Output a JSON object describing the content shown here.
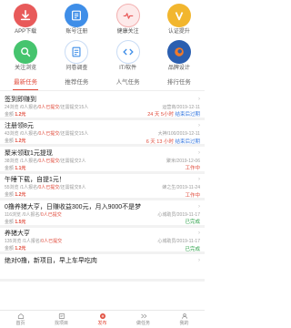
{
  "grid": [
    {
      "label": "APP下载",
      "icon": "download-icon",
      "color": "#e85a5a"
    },
    {
      "label": "账号注册",
      "icon": "register-icon",
      "color": "#3f8ee8"
    },
    {
      "label": "健康关注",
      "icon": "health-icon",
      "color": "#f07070"
    },
    {
      "label": "认证提升",
      "icon": "verify-icon",
      "color": "#f2b62e"
    },
    {
      "label": "关注浏览",
      "icon": "browse-icon",
      "color": "#46c46e"
    },
    {
      "label": "问卷调查",
      "icon": "survey-icon",
      "color": "#3f8ee8"
    },
    {
      "label": "IT/软件",
      "icon": "software-icon",
      "color": "#3f8ee8"
    },
    {
      "label": "品牌设计",
      "icon": "firefox-icon",
      "color": "#f07a2a"
    }
  ],
  "tabs": [
    "最新任务",
    "推荐任务",
    "人气任务",
    "排行任务"
  ],
  "items": [
    {
      "title": "签到即赚到",
      "meta_a": "24浏览 /0人报名/",
      "meta_hl": "0人已提交",
      "meta_b": "/还需提交15人",
      "right": "运营商/2019-12-11",
      "reward_pre": "金额",
      "reward": "1.2元",
      "timer": "24 天 5小时",
      "status": "结束后过期"
    },
    {
      "title": "注册领8元",
      "meta_a": "43浏览 /0人报名/",
      "meta_hl": "0人已提交",
      "meta_b": "/还需提交15人",
      "right": "大神/100/2019-12-11",
      "reward_pre": "金额",
      "reward": "1.2元",
      "timer": "6 天 13 小时",
      "status": "结束后过期"
    },
    {
      "title": "聚米领取1元提现",
      "meta_a": "38浏览 /1人报名/",
      "meta_hl": "0人已提交",
      "meta_b": "/还需提交2人",
      "right": "聚米/2019-12-06",
      "reward_pre": "金额",
      "reward": "1.1元",
      "timer": "",
      "status": "工作中"
    },
    {
      "title": "午睡下载，自提1元！",
      "meta_a": "55浏览 /1人报名/",
      "meta_hl": "0人已提交",
      "meta_b": "/还需提交8人",
      "right": "蜂之生/2019-11-24",
      "reward_pre": "金额",
      "reward": "1.2元",
      "timer": "",
      "status": "工作中"
    },
    {
      "title": "0撸养猪大亨，日赚收益300元，月入9000不是梦",
      "meta_a": "116浏览 /0人报名/",
      "meta_hl": "0人已提交",
      "meta_b": "",
      "right": "心城助员/2019-11-17",
      "reward_pre": "金额",
      "reward": "1.5元",
      "timer": "",
      "status": "已完成"
    },
    {
      "title": "养猪大亨",
      "meta_a": "135浏览 /1人报名/",
      "meta_hl": "0人已提交",
      "meta_b": "",
      "right": "心城助员/2019-11-17",
      "reward_pre": "金额",
      "reward": "1.2元",
      "timer": "",
      "status": "已完成"
    },
    {
      "title": "绝对0撸，新项目，早上车早吃肉",
      "meta_a": "",
      "meta_hl": "",
      "meta_b": "",
      "right": "",
      "reward_pre": "",
      "reward": "",
      "timer": "",
      "status": ""
    }
  ],
  "bottom_nav": [
    {
      "label": "首页",
      "icon": "home-icon"
    },
    {
      "label": "找项目",
      "icon": "project-icon"
    },
    {
      "label": "发布",
      "icon": "publish-icon"
    },
    {
      "label": "做任务",
      "icon": "task-icon"
    },
    {
      "label": "我的",
      "icon": "user-icon"
    }
  ]
}
